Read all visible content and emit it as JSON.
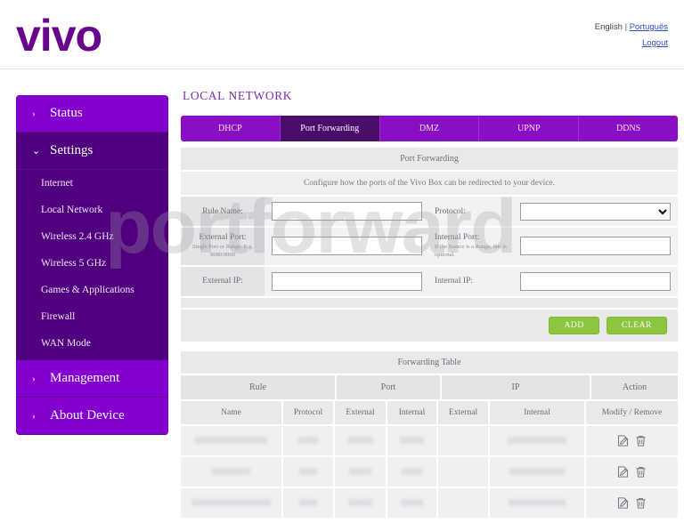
{
  "header": {
    "logo_text": "vivo",
    "lang_en": "English",
    "lang_sep": "|",
    "lang_pt": "Português",
    "logout": "Logout"
  },
  "sidebar": {
    "items": [
      {
        "label": "Status",
        "icon": "chevron-right-icon",
        "type": "top",
        "state": "collapsed"
      },
      {
        "label": "Settings",
        "icon": "chevron-down-icon",
        "type": "top",
        "state": "expanded"
      },
      {
        "label": "Internet",
        "type": "sub"
      },
      {
        "label": "Local Network",
        "type": "sub"
      },
      {
        "label": "Wireless 2.4 GHz",
        "type": "sub"
      },
      {
        "label": "Wireless 5 GHz",
        "type": "sub"
      },
      {
        "label": "Games & Applications",
        "type": "sub"
      },
      {
        "label": "Firewall",
        "type": "sub"
      },
      {
        "label": "WAN Mode",
        "type": "sub"
      },
      {
        "label": "Management",
        "icon": "chevron-right-icon",
        "type": "top",
        "state": "collapsed"
      },
      {
        "label": "About Device",
        "icon": "chevron-right-icon",
        "type": "top",
        "state": "collapsed"
      }
    ]
  },
  "main": {
    "page_title": "LOCAL NETWORK",
    "tabs": [
      {
        "label": "DHCP",
        "active": false
      },
      {
        "label": "Port Forwarding",
        "active": true
      },
      {
        "label": "DMZ",
        "active": false
      },
      {
        "label": "UPNP",
        "active": false
      },
      {
        "label": "DDNS",
        "active": false
      }
    ],
    "section_title": "Port Forwarding",
    "description": "Configure how the ports of the Vivo Box can be redirected to your device.",
    "form": {
      "rule_name_label": "Rule Name:",
      "rule_name_value": "",
      "protocol_label": "Protocol:",
      "protocol_value": "",
      "protocol_options": [
        ""
      ],
      "external_port_label": "External Port:",
      "external_port_hint": "Single Port or Range.\nE.g. 8080:9090",
      "external_port_value": "",
      "internal_port_label": "Internal Port:",
      "internal_port_hint": "If the Source is a Range,\nthis is optional.",
      "internal_port_value": "",
      "external_ip_label": "External IP:",
      "external_ip_value": "",
      "internal_ip_label": "Internal IP:",
      "internal_ip_value": "",
      "add_button": "ADD",
      "clear_button": "CLEAR"
    },
    "table": {
      "title": "Forwarding Table",
      "group_headers": [
        "Rule",
        "Port",
        "IP",
        "Action"
      ],
      "sub_headers": [
        "Name",
        "Protocol",
        "External",
        "Internal",
        "External",
        "Internal",
        "Modify / Remove"
      ],
      "rows": [
        {
          "name": "",
          "protocol": "",
          "ext_port": "",
          "int_port": "",
          "ext_ip": "",
          "int_ip": "",
          "actions": [
            "edit-icon",
            "trash-icon"
          ]
        },
        {
          "name": "",
          "protocol": "",
          "ext_port": "",
          "int_port": "",
          "ext_ip": "",
          "int_ip": "",
          "actions": [
            "edit-icon",
            "trash-icon"
          ]
        },
        {
          "name": "",
          "protocol": "",
          "ext_port": "",
          "int_port": "",
          "ext_ip": "",
          "int_ip": "",
          "actions": [
            "edit-icon",
            "trash-icon"
          ]
        }
      ]
    }
  },
  "watermark": {
    "text": "portforward"
  },
  "colors": {
    "brand_purple": "#69048c",
    "sidebar_dark": "#50007e",
    "sidebar_light": "#8300cf",
    "tab_inactive": "#8a0fc4",
    "tab_active": "#4a0d6b",
    "title_purple": "#7a2fb0",
    "button_green": "#8cc63f",
    "link_blue": "#2a51c8"
  }
}
